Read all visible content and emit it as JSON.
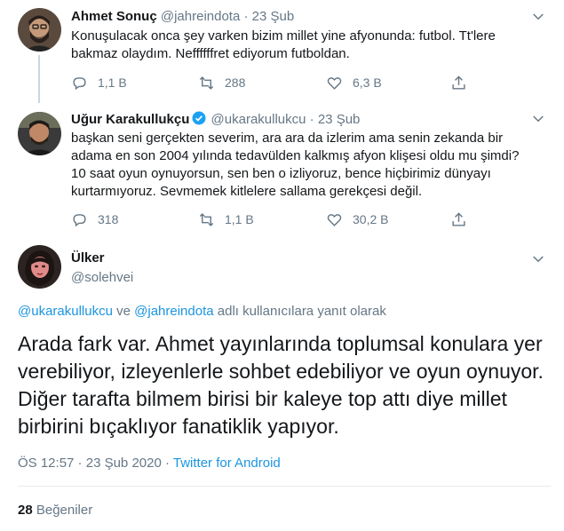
{
  "tweets": [
    {
      "name": "Ahmet Sonuç",
      "handle": "@jahreindota",
      "dot": "·",
      "time": "23 Şub",
      "text": "Konuşulacak onca şey varken bizim millet yine afyonunda: futbol. Tt'lere bakmaz olaydım. Neffffffret ediyorum futboldan.",
      "replies": "1,1 B",
      "retweets": "288",
      "likes": "6,3 B"
    },
    {
      "name": "Uğur Karakullukçu",
      "handle": "@ukarakullukcu",
      "dot": "·",
      "time": "23 Şub",
      "text": "başkan seni gerçekten severim, ara ara da izlerim ama senin zekanda bir adama en son 2004 yılında tedavülden kalkmış afyon klişesi oldu mu şimdi? 10 saat oyun oynuyorsun, sen ben o izliyoruz, bence hiçbirimiz dünyayı kurtarmıyoruz. Sevmemek kitlelere sallama gerekçesi değil.",
      "replies": "318",
      "retweets": "1,1 B",
      "likes": "30,2 B"
    }
  ],
  "main": {
    "name": "Ülker",
    "handle": "@solehvei",
    "reply_to": {
      "user1": "@ukarakullukcu",
      "and": " ve ",
      "user2": "@jahreindota",
      "suffix": " adlı kullanıcılara yanıt olarak"
    },
    "text": "Arada fark var. Ahmet yayınlarında toplumsal konulara yer verebiliyor, izleyenlerle sohbet edebiliyor ve oyun oynuyor. Diğer tarafta bilmem birisi bir kaleye top attı diye millet birbirini bıçaklıyor fanatiklik yapıyor.",
    "time": "ÖS 12:57",
    "sep": " · ",
    "date": "23 Şub 2020",
    "source": "Twitter for Android",
    "likes_count": "28",
    "likes_label": " Beğeniler"
  },
  "colors": {
    "text": "#14171a",
    "secondary": "#657786",
    "link": "#1b95e0",
    "verified": "#1da1f2",
    "divider": "#e6ecf0"
  },
  "icons": [
    "reply-icon",
    "retweet-icon",
    "like-icon",
    "share-icon",
    "chevron-down-icon",
    "verified-badge-icon"
  ]
}
